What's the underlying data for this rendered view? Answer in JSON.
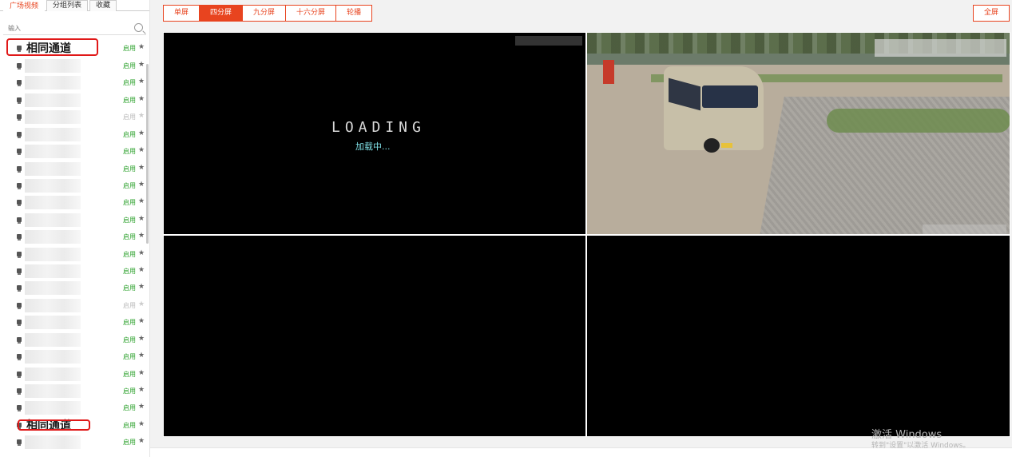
{
  "sidebar": {
    "tabs": [
      {
        "label": "广场视频",
        "active": true
      },
      {
        "label": "分组列表",
        "active": false
      },
      {
        "label": "收藏",
        "active": false
      }
    ],
    "search_placeholder": "输入",
    "rows": [
      {
        "name": "相同通道",
        "status": "启用",
        "enabled": true,
        "highlight": "top"
      },
      {
        "name": "",
        "status": "启用",
        "enabled": true
      },
      {
        "name": "",
        "status": "启用",
        "enabled": true
      },
      {
        "name": "",
        "status": "启用",
        "enabled": true
      },
      {
        "name": "",
        "status": "启用",
        "enabled": false
      },
      {
        "name": "",
        "status": "启用",
        "enabled": true
      },
      {
        "name": "",
        "status": "启用",
        "enabled": true
      },
      {
        "name": "",
        "status": "启用",
        "enabled": true
      },
      {
        "name": "",
        "status": "启用",
        "enabled": true
      },
      {
        "name": "",
        "status": "启用",
        "enabled": true
      },
      {
        "name": "",
        "status": "启用",
        "enabled": true
      },
      {
        "name": "",
        "status": "启用",
        "enabled": true
      },
      {
        "name": "",
        "status": "启用",
        "enabled": true
      },
      {
        "name": "",
        "status": "启用",
        "enabled": true
      },
      {
        "name": "",
        "status": "启用",
        "enabled": true
      },
      {
        "name": "",
        "status": "启用",
        "enabled": false
      },
      {
        "name": "",
        "status": "启用",
        "enabled": true
      },
      {
        "name": "",
        "status": "启用",
        "enabled": true
      },
      {
        "name": "",
        "status": "启用",
        "enabled": true
      },
      {
        "name": "",
        "status": "启用",
        "enabled": true
      },
      {
        "name": "",
        "status": "启用",
        "enabled": true
      },
      {
        "name": "",
        "status": "启用",
        "enabled": true
      },
      {
        "name": "相同通道",
        "status": "启用",
        "enabled": true,
        "highlight": "bottom"
      },
      {
        "name": "",
        "status": "启用",
        "enabled": true
      }
    ]
  },
  "toolbar": {
    "buttons": [
      {
        "label": "单屏",
        "active": false
      },
      {
        "label": "四分屏",
        "active": true
      },
      {
        "label": "九分屏",
        "active": false
      },
      {
        "label": "十六分屏",
        "active": false
      },
      {
        "label": "轮播",
        "active": false
      }
    ],
    "fullscreen_label": "全屏"
  },
  "video": {
    "loading_word": "LOADING",
    "loading_text": "加载中..."
  },
  "watermark": {
    "line1": "激活 Windows",
    "line2": "转到\"设置\"以激活 Windows。"
  },
  "colors": {
    "accent": "#e8441f",
    "enabled": "#2aa02a",
    "highlight": "#e01818"
  }
}
